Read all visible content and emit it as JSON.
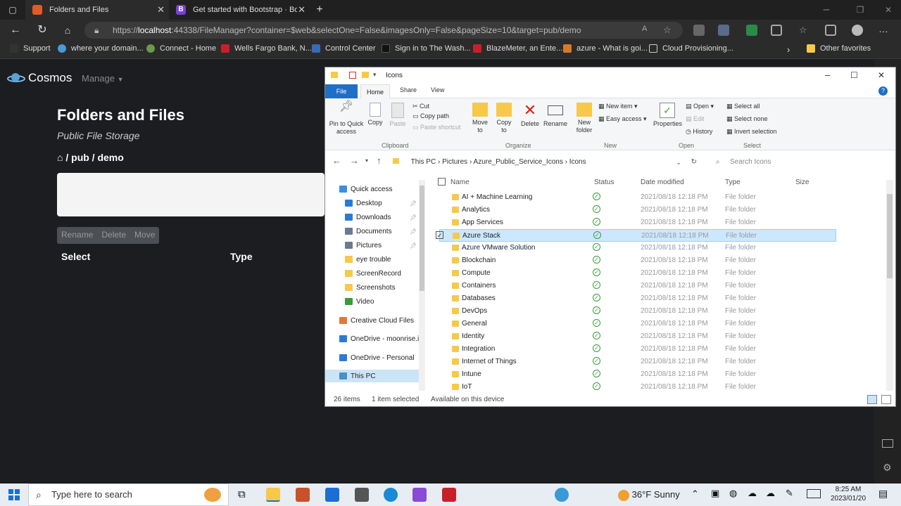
{
  "browser": {
    "tabs": [
      {
        "title": "Folders and Files",
        "active": true
      },
      {
        "title": "Get started with Bootstrap · Boo",
        "active": false
      }
    ],
    "url_prefix": "https://",
    "url_host": "localhost",
    "url_rest": ":44338/FileManager?container=$web&selectOne=False&imagesOnly=False&pageSize=10&target=pub/demo",
    "favorites": [
      "Support",
      "where your domain...",
      "Connect - Home",
      "Wells Fargo Bank, N...",
      "Control Center",
      "Sign in to The Wash...",
      "BlazeMeter, an Ente...",
      "azure - What is goi...",
      "Cloud Provisioning...",
      "Other favorites"
    ]
  },
  "app": {
    "brand": "Cosmos",
    "manage_label": "Manage",
    "page_title": "Folders and Files",
    "subtitle": "Public File Storage",
    "breadcrumb": "/ pub / demo",
    "buttons": [
      "Rename",
      "Delete",
      "Move"
    ],
    "table_headers": {
      "select": "Select",
      "type": "Type"
    }
  },
  "explorer": {
    "title": "Icons",
    "ribbon_tabs": [
      "File",
      "Home",
      "Share",
      "View"
    ],
    "ribbon": {
      "pin": "Pin to Quick access",
      "copy": "Copy",
      "paste": "Paste",
      "cut": "Cut",
      "copy_path": "Copy path",
      "paste_shortcut": "Paste shortcut",
      "move_to": "Move to",
      "copy_to": "Copy to",
      "delete": "Delete",
      "rename": "Rename",
      "new_folder": "New folder",
      "new_item": "New item",
      "easy_access": "Easy access",
      "properties": "Properties",
      "open": "Open",
      "edit": "Edit",
      "history": "History",
      "select_all": "Select all",
      "select_none": "Select none",
      "invert_selection": "Invert selection",
      "groups": [
        "Clipboard",
        "Organize",
        "New",
        "Open",
        "Select"
      ]
    },
    "path": [
      "This PC",
      "Pictures",
      "Azure_Public_Service_Icons",
      "Icons"
    ],
    "search_placeholder": "Search Icons",
    "nav": [
      {
        "label": "Quick access",
        "color": "#3a8ee6"
      },
      {
        "label": "Desktop",
        "color": "#2a7bd6"
      },
      {
        "label": "Downloads",
        "color": "#2a7bd6"
      },
      {
        "label": "Documents",
        "color": "#6b7a8f"
      },
      {
        "label": "Pictures",
        "color": "#6b7a8f"
      },
      {
        "label": "eye trouble",
        "color": "#f7c948"
      },
      {
        "label": "ScreenRecord",
        "color": "#f7c948"
      },
      {
        "label": "Screenshots",
        "color": "#f7c948"
      },
      {
        "label": "Video",
        "color": "#3a9a3a"
      },
      {
        "label": "Creative Cloud Files",
        "color": "#e07a3a"
      },
      {
        "label": "OneDrive - moonrise.i",
        "color": "#2a7bd6"
      },
      {
        "label": "OneDrive - Personal",
        "color": "#2a7bd6"
      },
      {
        "label": "This PC",
        "color": "#4a90c8"
      }
    ],
    "columns": {
      "name": "Name",
      "status": "Status",
      "date": "Date modified",
      "type": "Type",
      "size": "Size"
    },
    "files": [
      {
        "name": "AI + Machine Learning",
        "date": "2021/08/18 12:18 PM",
        "type": "File folder"
      },
      {
        "name": "Analytics",
        "date": "2021/08/18 12:18 PM",
        "type": "File folder"
      },
      {
        "name": "App Services",
        "date": "2021/08/18 12:18 PM",
        "type": "File folder"
      },
      {
        "name": "Azure Stack",
        "date": "2021/08/18 12:18 PM",
        "type": "File folder",
        "selected": true
      },
      {
        "name": "Azure VMware Solution",
        "date": "2021/08/18 12:18 PM",
        "type": "File folder"
      },
      {
        "name": "Blockchain",
        "date": "2021/08/18 12:18 PM",
        "type": "File folder"
      },
      {
        "name": "Compute",
        "date": "2021/08/18 12:18 PM",
        "type": "File folder"
      },
      {
        "name": "Containers",
        "date": "2021/08/18 12:18 PM",
        "type": "File folder"
      },
      {
        "name": "Databases",
        "date": "2021/08/18 12:18 PM",
        "type": "File folder"
      },
      {
        "name": "DevOps",
        "date": "2021/08/18 12:18 PM",
        "type": "File folder"
      },
      {
        "name": "General",
        "date": "2021/08/18 12:18 PM",
        "type": "File folder"
      },
      {
        "name": "Identity",
        "date": "2021/08/18 12:18 PM",
        "type": "File folder"
      },
      {
        "name": "Integration",
        "date": "2021/08/18 12:18 PM",
        "type": "File folder"
      },
      {
        "name": "Internet of Things",
        "date": "2021/08/18 12:18 PM",
        "type": "File folder"
      },
      {
        "name": "Intune",
        "date": "2021/08/18 12:18 PM",
        "type": "File folder"
      },
      {
        "name": "IoT",
        "date": "2021/08/18 12:18 PM",
        "type": "File folder"
      }
    ],
    "status": {
      "items": "26 items",
      "selected": "1 item selected",
      "availability": "Available on this device"
    }
  },
  "taskbar": {
    "search_placeholder": "Type here to search",
    "weather": "36°F  Sunny",
    "time": "8:25 AM",
    "date": "2023/01/20"
  }
}
